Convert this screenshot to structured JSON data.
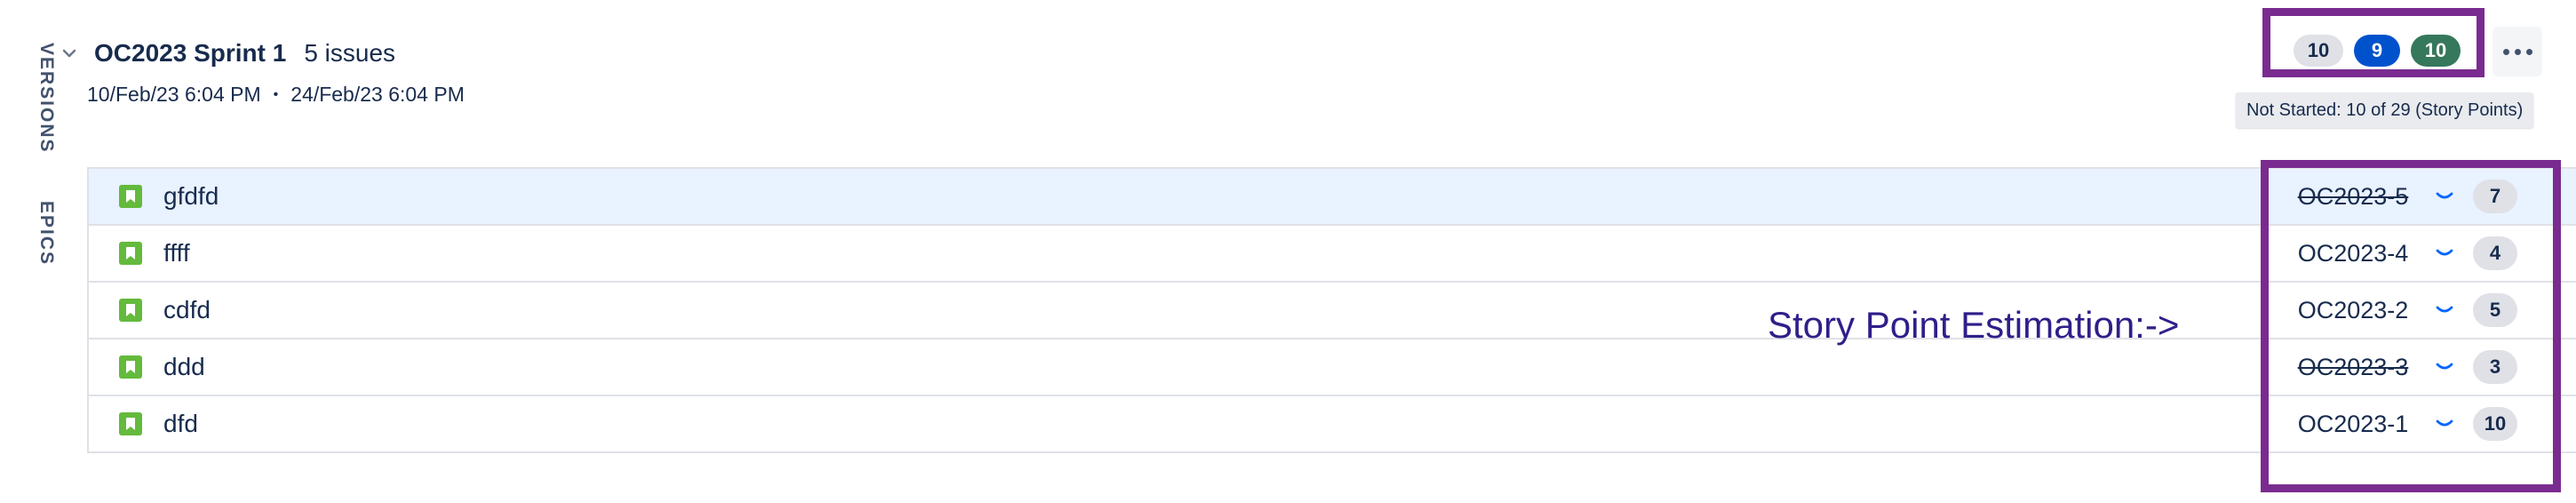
{
  "sidebar": {
    "tabs": [
      {
        "label": "VERSIONS"
      },
      {
        "label": "EPICS"
      }
    ]
  },
  "sprint": {
    "name": "OC2023 Sprint 1",
    "issue_count": "5 issues",
    "start": "10/Feb/23 6:04 PM",
    "separator": "•",
    "end": "24/Feb/23 6:04 PM"
  },
  "status_summary": {
    "not_started": "10",
    "in_progress": "9",
    "done": "10",
    "tooltip": "Not Started: 10 of 29 (Story Points)"
  },
  "issues": [
    {
      "summary": "gfdfd",
      "key": "OC2023-5",
      "points": "7",
      "done": true,
      "selected": true
    },
    {
      "summary": "ffff",
      "key": "OC2023-4",
      "points": "4",
      "done": false,
      "selected": false
    },
    {
      "summary": "cdfd",
      "key": "OC2023-2",
      "points": "5",
      "done": false,
      "selected": false
    },
    {
      "summary": "ddd",
      "key": "OC2023-3",
      "points": "3",
      "done": true,
      "selected": false
    },
    {
      "summary": "dfd",
      "key": "OC2023-1",
      "points": "10",
      "done": false,
      "selected": false
    }
  ],
  "annotation": {
    "text": "Story Point Estimation:->"
  },
  "colors": {
    "highlight_frame": "#7a2b8f",
    "in_progress": "#0052cc",
    "done": "#36785c",
    "story_icon": "#63ba3c",
    "annotation": "#2e1f8a"
  },
  "icons": {
    "collapse": "chevron-down-icon",
    "story": "bookmark-icon",
    "status": "chevron-down-icon",
    "more": "more-icon"
  }
}
